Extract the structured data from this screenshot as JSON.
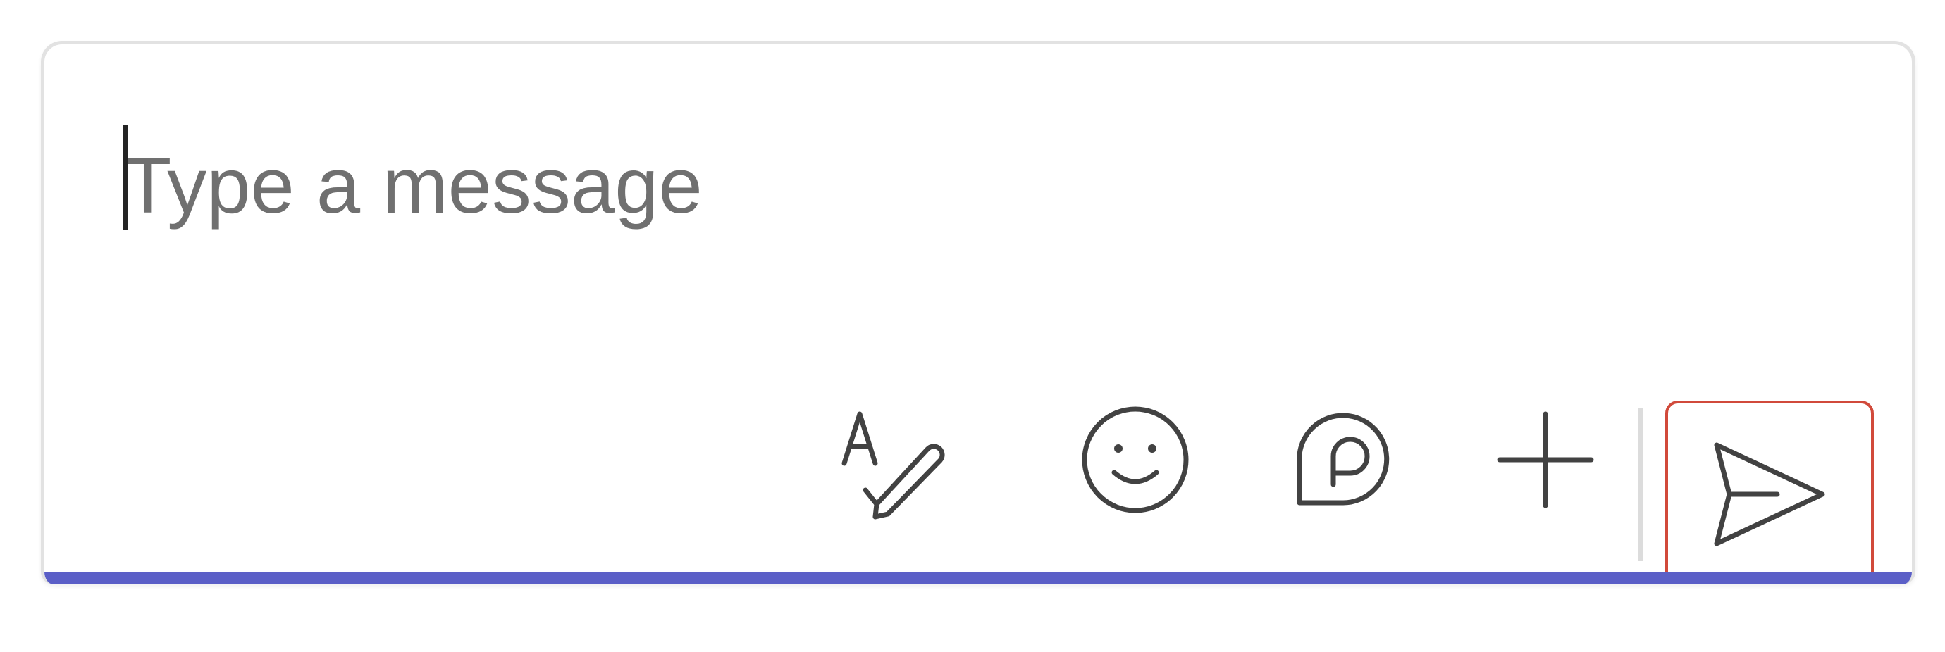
{
  "composer": {
    "placeholder": "Type a message",
    "value": ""
  },
  "toolbar": {
    "buttons": [
      {
        "name": "format-button",
        "icon": "format-text-pen-icon"
      },
      {
        "name": "emoji-button",
        "icon": "smiley-face-icon"
      },
      {
        "name": "loop-button",
        "icon": "loop-component-icon"
      },
      {
        "name": "attach-button",
        "icon": "plus-icon"
      }
    ],
    "send": {
      "icon": "send-arrow-icon"
    }
  },
  "colors": {
    "accent": "#5b5fc7",
    "icon": "#424242",
    "placeholder": "#707070",
    "send_highlight": "#d14a3b",
    "border": "#e2e2e2"
  }
}
